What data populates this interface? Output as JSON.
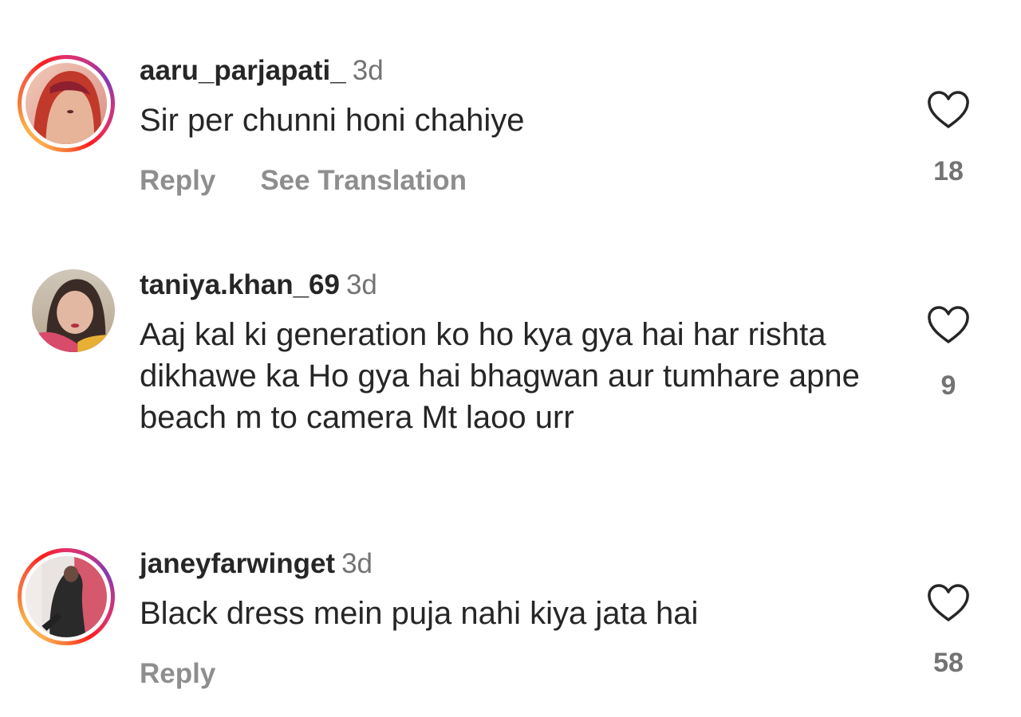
{
  "comments": [
    {
      "username": "aaru_parjapati_",
      "time": "3d",
      "text": "Sir per chunni honi chahiye",
      "reply_label": "Reply",
      "translate_label": "See Translation",
      "likes": "18",
      "avatar_story_ring": true
    },
    {
      "username": "taniya.khan_69",
      "time": "3d",
      "text": "Aaj kal ki generation ko ho kya gya hai har rishta dikhawe ka Ho gya hai bhagwan aur tumhare apne beach m to camera Mt laoo urr",
      "likes": "9",
      "avatar_story_ring": false
    },
    {
      "username": "janeyfarwinget",
      "time": "3d",
      "text": "Black dress mein puja nahi kiya jata hai",
      "reply_label": "Reply",
      "likes": "58",
      "avatar_story_ring": true
    }
  ],
  "icons": {
    "like": "heart-outline-icon"
  },
  "colors": {
    "text": "#262626",
    "secondary": "#737373",
    "action": "#8e8e8e",
    "story_ring_start": "#fbad50",
    "story_ring_end": "#c13584"
  }
}
